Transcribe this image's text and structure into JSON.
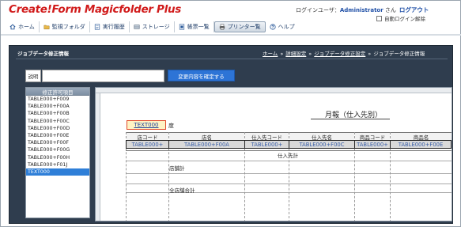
{
  "app": {
    "logo": "Create!Form Magicfolder Plus",
    "login_prefix": "ログインユーザ：",
    "user": "Administrator",
    "user_suffix": "さん",
    "logout": "ログアウト",
    "auto_login_release": "自動ログイン解除"
  },
  "nav": {
    "items": [
      {
        "label": "ホーム",
        "icon": "home-icon"
      },
      {
        "label": "監視フォルダ",
        "icon": "folder-icon"
      },
      {
        "label": "実行履歴",
        "icon": "history-icon"
      },
      {
        "label": "ストレージ",
        "icon": "storage-icon"
      },
      {
        "label": "帳票一覧",
        "icon": "form-list-icon"
      },
      {
        "label": "プリンター覧",
        "icon": "printer-icon",
        "active": true
      },
      {
        "label": "ヘルプ",
        "icon": "help-icon"
      }
    ]
  },
  "panel": {
    "title": "ジョブデータ修正情報",
    "breadcrumb": [
      "ホーム",
      "詳細設定",
      "ジョブデータ修正設定",
      "ジョブデータ修正情報"
    ],
    "desc_label": "説明",
    "desc_value": "",
    "confirm_button": "変更内容を確定する"
  },
  "items_list": {
    "header": "修正許可項目",
    "items": [
      "TABLE000+F009",
      "TABLE000+F00A",
      "TABLE000+F00B",
      "TABLE000+F00C",
      "TABLE000+F00D",
      "TABLE000+F00E",
      "TABLE000+F00F",
      "TABLE000+F00G",
      "TABLE000+F00H",
      "TABLE000+F01J",
      "TEXT000"
    ],
    "selected": "TEXT000"
  },
  "report": {
    "title": "月報（仕入先別）",
    "text_field": "TEXT000",
    "text_suffix": "度",
    "headers": [
      "店コード",
      "店名",
      "仕入先コード",
      "仕入先名",
      "商品コード",
      "商品名"
    ],
    "fields": [
      "TABLE000+",
      "TABLE000+F00A",
      "TABLE000+",
      "TABLE000+F00C",
      "TABLE000+",
      "TABLE000+F00E"
    ],
    "subtotal_supplier": "仕入先計",
    "subtotal_store": "店舗計",
    "grand_total": "全店舗合計"
  },
  "colors": {
    "logo": "#d11b1b",
    "panel_bg": "#2f3d4e",
    "confirm_button": "#2d74d6",
    "selected_item": "#2f7fd8",
    "field_highlight_border": "#e04a2a",
    "field_highlight_bg": "#fff3c4",
    "link": "#1f4fa6"
  }
}
